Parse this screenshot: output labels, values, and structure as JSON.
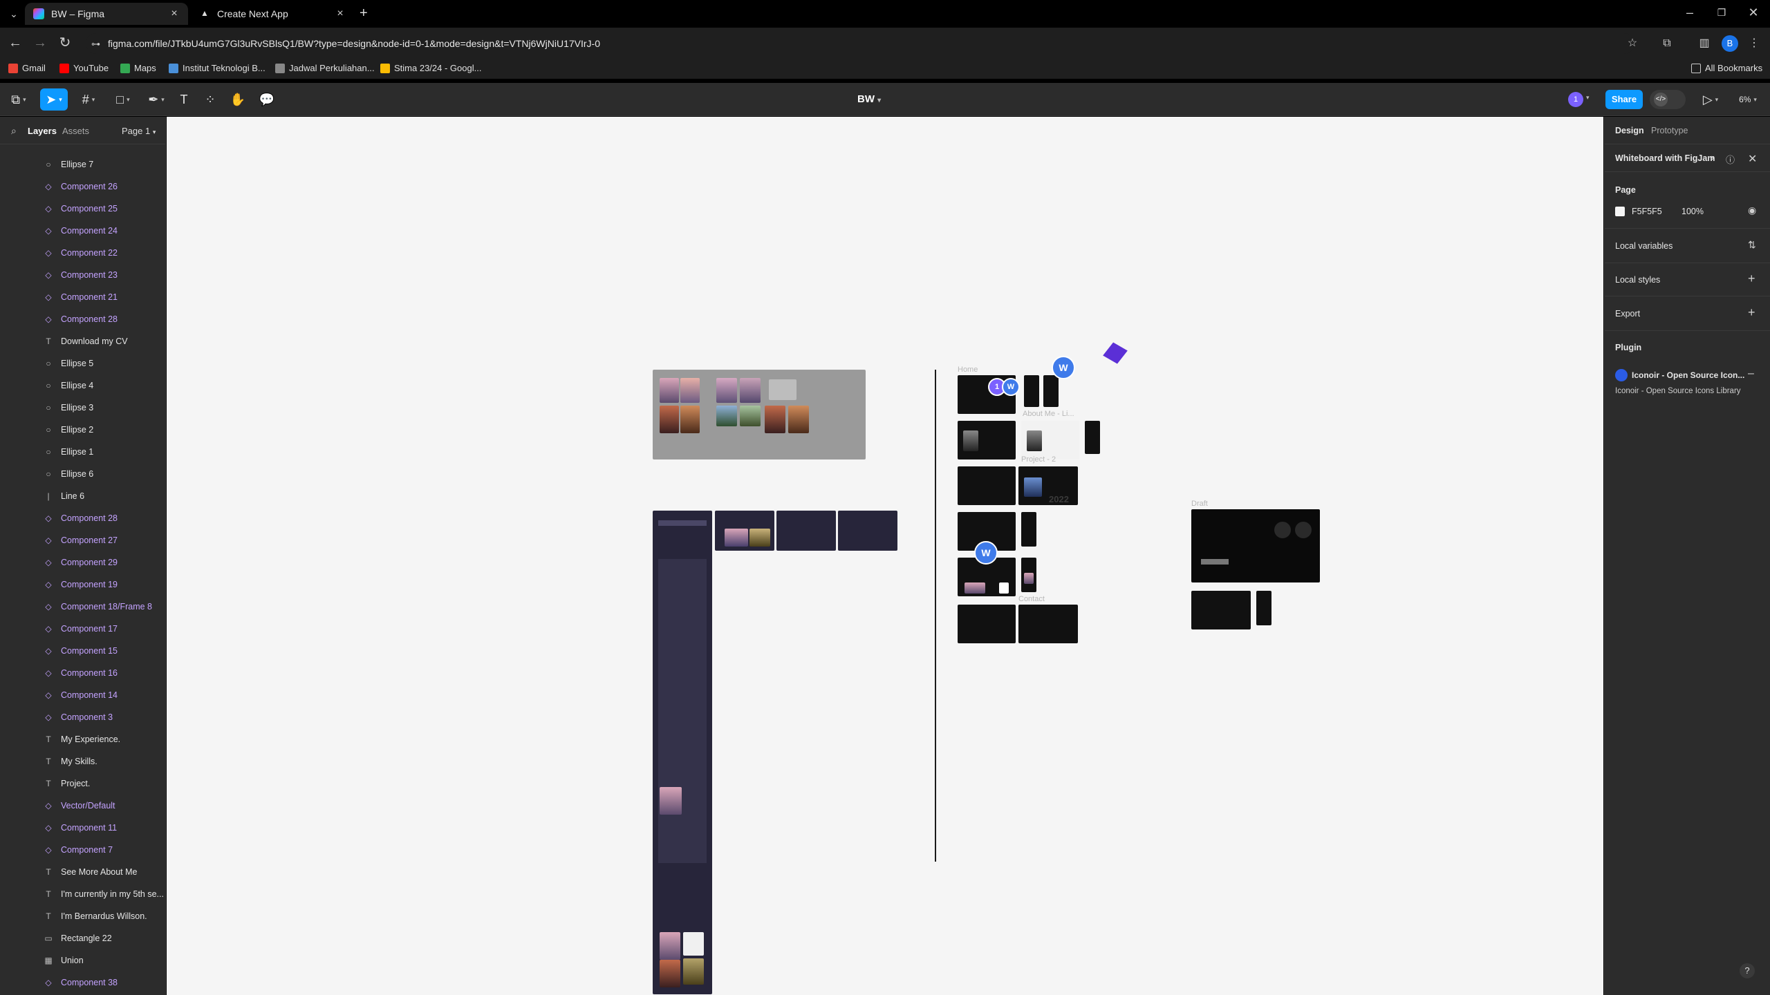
{
  "browser": {
    "tabs": [
      {
        "title": "BW – Figma",
        "active": true
      },
      {
        "title": "Create Next App",
        "active": false
      }
    ],
    "url": "figma.com/file/JTkbU4umG7Gl3uRvSBlsQ1/BW?type=design&node-id=0-1&mode=design&t=VTNj6WjNiU17VIrJ-0",
    "bookmarks": [
      "Gmail",
      "YouTube",
      "Maps",
      "Institut Teknologi B...",
      "Jadwal Perkuliahan...",
      "Stima 23/24 - Googl..."
    ],
    "all_bookmarks": "All Bookmarks",
    "profile_initial": "B"
  },
  "figma": {
    "file_name": "BW",
    "share_label": "Share",
    "zoom": "6%",
    "collaborator_count": "1",
    "left_tabs": {
      "layers": "Layers",
      "assets": "Assets",
      "page": "Page 1"
    },
    "layers": [
      {
        "name": "Ellipse 7",
        "type": "ellipse"
      },
      {
        "name": "Component 26",
        "type": "component"
      },
      {
        "name": "Component 25",
        "type": "component"
      },
      {
        "name": "Component 24",
        "type": "component"
      },
      {
        "name": "Component 22",
        "type": "component"
      },
      {
        "name": "Component 23",
        "type": "component"
      },
      {
        "name": "Component 21",
        "type": "component"
      },
      {
        "name": "Component 28",
        "type": "component"
      },
      {
        "name": "Download my CV",
        "type": "text"
      },
      {
        "name": "Ellipse 5",
        "type": "ellipse"
      },
      {
        "name": "Ellipse 4",
        "type": "ellipse"
      },
      {
        "name": "Ellipse 3",
        "type": "ellipse"
      },
      {
        "name": "Ellipse 2",
        "type": "ellipse"
      },
      {
        "name": "Ellipse 1",
        "type": "ellipse"
      },
      {
        "name": "Ellipse 6",
        "type": "ellipse"
      },
      {
        "name": "Line 6",
        "type": "line"
      },
      {
        "name": "Component 28",
        "type": "component"
      },
      {
        "name": "Component 27",
        "type": "component"
      },
      {
        "name": "Component 29",
        "type": "component"
      },
      {
        "name": "Component 19",
        "type": "component"
      },
      {
        "name": "Component 18/Frame 8",
        "type": "component"
      },
      {
        "name": "Component 17",
        "type": "component"
      },
      {
        "name": "Component 15",
        "type": "component"
      },
      {
        "name": "Component 16",
        "type": "component"
      },
      {
        "name": "Component 14",
        "type": "component"
      },
      {
        "name": "Component 3",
        "type": "component"
      },
      {
        "name": "My Experience.",
        "type": "text"
      },
      {
        "name": "My Skills.",
        "type": "text"
      },
      {
        "name": "Project.",
        "type": "text"
      },
      {
        "name": "Vector/Default",
        "type": "component"
      },
      {
        "name": "Component 11",
        "type": "component"
      },
      {
        "name": "Component 7",
        "type": "component"
      },
      {
        "name": "See More About Me",
        "type": "text"
      },
      {
        "name": "I'm currently in my 5th se...",
        "type": "text"
      },
      {
        "name": "I'm Bernardus Willson.",
        "type": "text"
      },
      {
        "name": "Rectangle 22",
        "type": "rect"
      },
      {
        "name": "Union",
        "type": "union"
      },
      {
        "name": "Component 38",
        "type": "component"
      }
    ],
    "canvas": {
      "frame_labels": {
        "home": "Home",
        "about": "About Me - Li...",
        "project": "Project - 2",
        "contact": "Contact",
        "draft": "Draft",
        "year": "2022"
      },
      "cursor_labels": [
        "W",
        "1",
        "W",
        "W"
      ]
    },
    "right": {
      "tabs": {
        "design": "Design",
        "prototype": "Prototype"
      },
      "whiteboard": "Whiteboard with FigJam",
      "page_label": "Page",
      "page_color": "F5F5F5",
      "page_opacity": "100%",
      "local_variables": "Local variables",
      "local_styles": "Local styles",
      "export": "Export",
      "plugin": "Plugin",
      "plugin_name": "Iconoir - Open Source Icon...",
      "plugin_desc": "Iconoir - Open Source Icons Library",
      "help": "?"
    }
  }
}
